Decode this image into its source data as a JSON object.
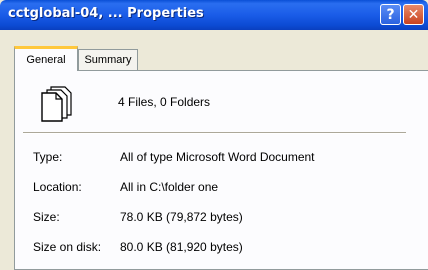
{
  "window": {
    "title": "cctglobal-04, ... Properties",
    "help_label": "?",
    "close_label": "✕"
  },
  "tabs": [
    {
      "label": "General"
    },
    {
      "label": "Summary"
    }
  ],
  "summary": "4 Files, 0 Folders",
  "properties": [
    {
      "label": "Type:",
      "value": "All of type Microsoft Word Document"
    },
    {
      "label": "Location:",
      "value": "All in C:\\folder one"
    },
    {
      "label": "Size:",
      "value": "78.0 KB (79,872 bytes)"
    },
    {
      "label": "Size on disk:",
      "value": "80.0 KB (81,920 bytes)"
    }
  ],
  "colors": {
    "titlebar": "#0a4fd6",
    "dialog_bg": "#ece9d8",
    "active_tab_accent": "#ffc83c",
    "close_button": "#c9431f"
  }
}
